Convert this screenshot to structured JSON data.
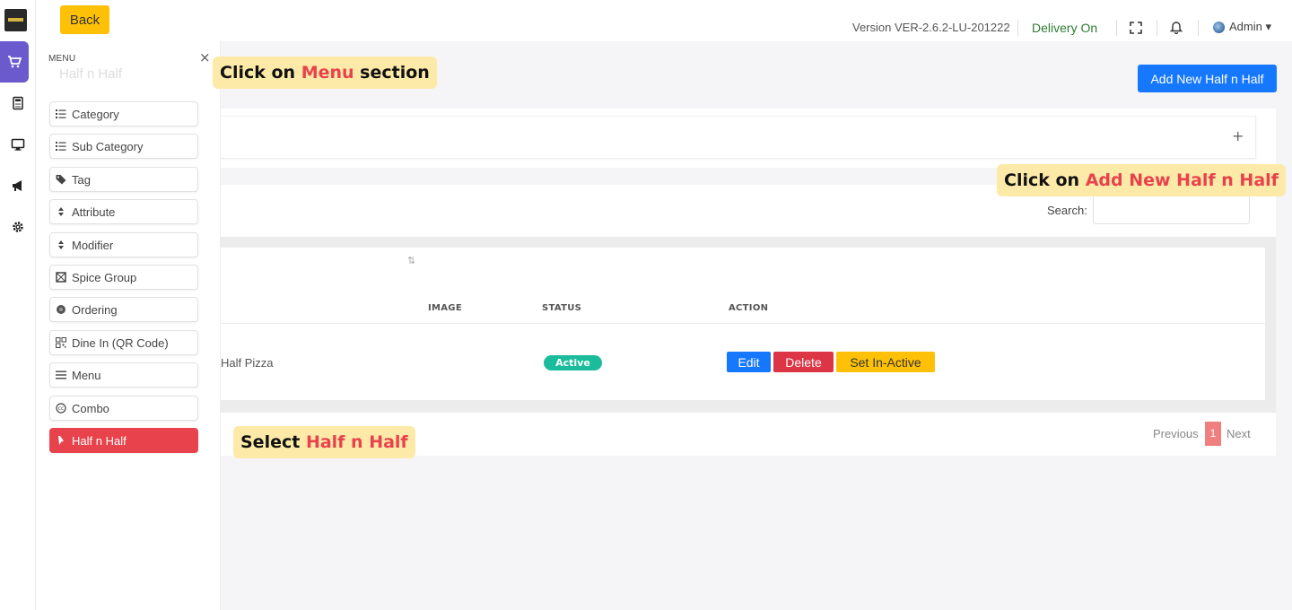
{
  "topbar": {
    "back_label": "Back",
    "version": "Version VER-2.6.2-LU-201222",
    "delivery_status": "Delivery On",
    "user_label": "Admin ▾"
  },
  "rail": {
    "icons": [
      "logo",
      "cart-icon",
      "calculator-icon",
      "monitor-icon",
      "megaphone-icon",
      "gear-icon"
    ],
    "active": "cart-icon"
  },
  "menu_panel": {
    "title": "MENU",
    "close_glyph": "×",
    "ghost_title": "Half n Half",
    "items": [
      {
        "label": "Category",
        "icon": "list-icon"
      },
      {
        "label": "Sub Category",
        "icon": "list-icon"
      },
      {
        "label": "Tag",
        "icon": "tag-icon"
      },
      {
        "label": "Attribute",
        "icon": "sort-icon"
      },
      {
        "label": "Modifier",
        "icon": "sort-icon"
      },
      {
        "label": "Spice Group",
        "icon": "grid-icon"
      },
      {
        "label": "Ordering",
        "icon": "circle-icon"
      },
      {
        "label": "Dine In (QR Code)",
        "icon": "qr-icon"
      },
      {
        "label": "Menu",
        "icon": "bars-icon"
      },
      {
        "label": "Combo",
        "icon": "combo-icon"
      },
      {
        "label": "Half n Half",
        "icon": "half-icon",
        "active": true
      }
    ]
  },
  "main": {
    "add_button_label": "Add New Half n Half",
    "plus_glyph": "+",
    "search_label": "Search:",
    "sort_glyph": "⇅",
    "columns": [
      "IMAGE",
      "STATUS",
      "ACTION"
    ],
    "rows": [
      {
        "name": "Half Pizza",
        "status": "Active",
        "actions": [
          "Edit",
          "Delete",
          "Set In-Active"
        ]
      }
    ],
    "pagination": {
      "previous": "Previous",
      "current": "1",
      "next": "Next"
    }
  },
  "callouts": {
    "menu": {
      "prefix": "Click on ",
      "highlight": "Menu",
      "suffix": " section"
    },
    "add": {
      "prefix": "Click on ",
      "highlight": "Add New Half n Half",
      "suffix": ""
    },
    "select": {
      "prefix": "Select ",
      "highlight": "Half n Half",
      "suffix": ""
    }
  },
  "colors": {
    "accent_red": "#e8424c",
    "primary_blue": "#1677ff",
    "warning_yellow": "#ffc107",
    "active_green": "#1abc9c",
    "rail_active": "#6a5acd",
    "callout_bg": "#fdeaa8"
  }
}
